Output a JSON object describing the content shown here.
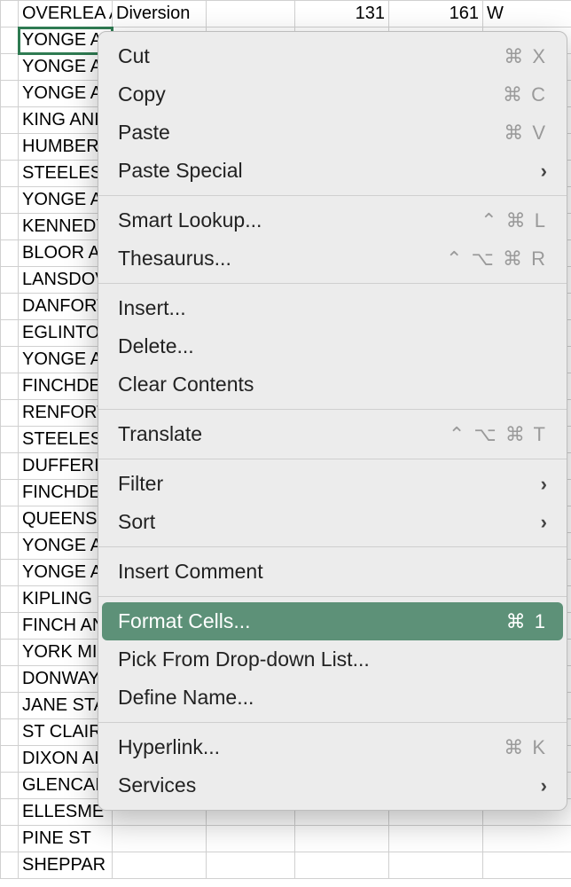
{
  "spreadsheet": {
    "rows": [
      {
        "a": "OVERLEA AND",
        "b": "Diversion",
        "c": "",
        "d": "131",
        "e": "161",
        "f": "W"
      },
      {
        "a": "YONGE AN",
        "selected": true
      },
      {
        "a": "YONGE A"
      },
      {
        "a": "YONGE A"
      },
      {
        "a": "KING ANI"
      },
      {
        "a": "HUMBERI"
      },
      {
        "a": "STEELES A"
      },
      {
        "a": "YONGE A"
      },
      {
        "a": "KENNEDY"
      },
      {
        "a": "BLOOR A"
      },
      {
        "a": "LANSDOV"
      },
      {
        "a": "DANFORT"
      },
      {
        "a": "EGLINTO"
      },
      {
        "a": "YONGE A"
      },
      {
        "a": "FINCHDE"
      },
      {
        "a": "RENFORT"
      },
      {
        "a": "STEELES A"
      },
      {
        "a": "DUFFERII"
      },
      {
        "a": "FINCHDE"
      },
      {
        "a": "QUEENS C"
      },
      {
        "a": "YONGE A"
      },
      {
        "a": "YONGE A"
      },
      {
        "a": "KIPLING S"
      },
      {
        "a": "FINCH AN"
      },
      {
        "a": "YORK MII"
      },
      {
        "a": "DONWAY"
      },
      {
        "a": "JANE STA"
      },
      {
        "a": "ST CLAIR"
      },
      {
        "a": "DIXON AI"
      },
      {
        "a": "GLENCAI"
      },
      {
        "a": "ELLESME"
      },
      {
        "a": "PINE ST"
      },
      {
        "a": "SHEPPAR"
      }
    ]
  },
  "menu": {
    "groups": [
      [
        {
          "label": "Cut",
          "shortcut": "⌘ X",
          "name": "menu-cut"
        },
        {
          "label": "Copy",
          "shortcut": "⌘ C",
          "name": "menu-copy"
        },
        {
          "label": "Paste",
          "shortcut": "⌘ V",
          "name": "menu-paste"
        },
        {
          "label": "Paste Special",
          "submenu": true,
          "name": "menu-paste-special"
        }
      ],
      [
        {
          "label": "Smart Lookup...",
          "shortcut": "⌃ ⌘ L",
          "name": "menu-smart-lookup"
        },
        {
          "label": "Thesaurus...",
          "shortcut": "⌃ ⌥ ⌘ R",
          "name": "menu-thesaurus"
        }
      ],
      [
        {
          "label": "Insert...",
          "name": "menu-insert"
        },
        {
          "label": "Delete...",
          "name": "menu-delete"
        },
        {
          "label": "Clear Contents",
          "name": "menu-clear-contents"
        }
      ],
      [
        {
          "label": "Translate",
          "shortcut": "⌃ ⌥ ⌘ T",
          "name": "menu-translate"
        }
      ],
      [
        {
          "label": "Filter",
          "submenu": true,
          "name": "menu-filter"
        },
        {
          "label": "Sort",
          "submenu": true,
          "name": "menu-sort"
        }
      ],
      [
        {
          "label": "Insert Comment",
          "name": "menu-insert-comment"
        }
      ],
      [
        {
          "label": "Format Cells...",
          "shortcut": "⌘ 1",
          "highlight": true,
          "name": "menu-format-cells"
        },
        {
          "label": "Pick From Drop-down List...",
          "name": "menu-pick-dropdown"
        },
        {
          "label": "Define Name...",
          "name": "menu-define-name"
        }
      ],
      [
        {
          "label": "Hyperlink...",
          "shortcut": "⌘ K",
          "name": "menu-hyperlink"
        },
        {
          "label": "Services",
          "submenu": true,
          "name": "menu-services"
        }
      ]
    ]
  }
}
